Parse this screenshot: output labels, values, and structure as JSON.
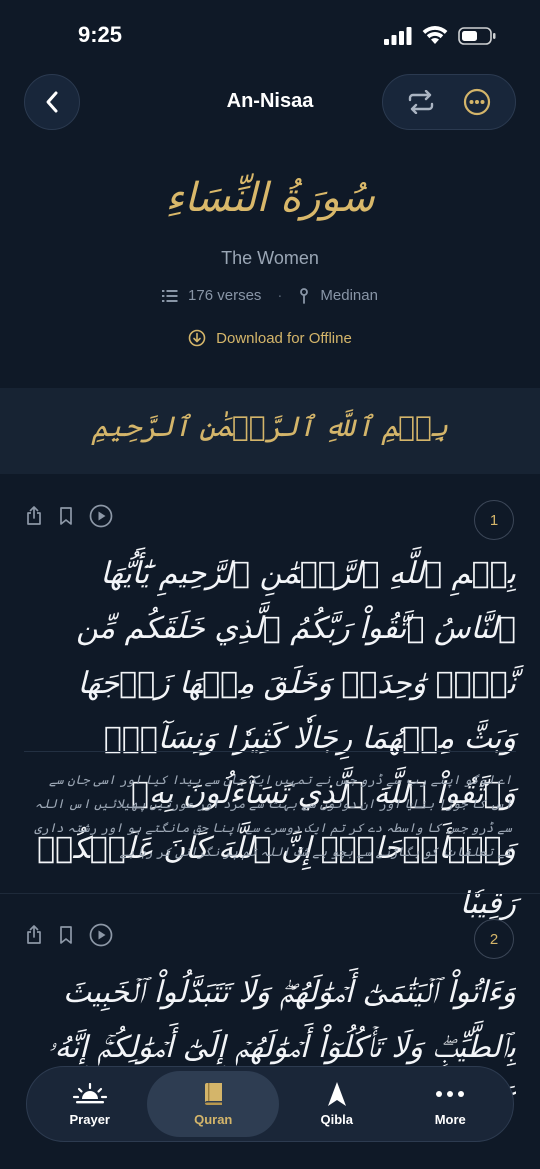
{
  "status": {
    "time": "9:25"
  },
  "header": {
    "title": "An-Nisaa"
  },
  "surah": {
    "arabic_name": "سُورَةُ النِّسَاءِ",
    "english_name": "The Women",
    "verses": "176 verses",
    "revelation": "Medinan",
    "download_label": "Download for Offline"
  },
  "bismillah": "بِسۡمِ ٱللَّهِ ٱلرَّحۡمَٰنِ ٱلرَّحِيمِ",
  "verses": [
    {
      "number": "1",
      "arabic": "بِسۡمِ ٱللَّهِ ٱلرَّحۡمَٰنِ ٱلرَّحِيمِ يَٰٓأَيُّهَا ٱلنَّاسُ ٱتَّقُواْ رَبَّكُمُ ٱلَّذِي خَلَقَكُم مِّن نَّفۡسٖ وَٰحِدَةٖ وَخَلَقَ مِنۡهَا زَوۡجَهَا وَبَثَّ مِنۡهُمَا رِجَالٗا كَثِيرٗا وَنِسَآءٗۚ وَٱتَّقُواْ ٱللَّهَ ٱلَّذِي تَسَآءَلُونَ بِهِۦ وَٱلۡأَرۡحَامَۚ إِنَّ ٱللَّهَ كَانَ عَلَيۡكُمۡ رَقِيبٗا",
      "translation": "اے لوگو اپنے رب سے ڈرو جس نے تمہیں ایک جان سے پیدا کیا اور اسی جان سے اس کا جوڑا بنایا اور ان دونوں سے بہت سے مرد اور عورتیں پھیلائیں اس اللہ سے ڈرو جس کا واسطہ دے کر تم ایک دوسرے سے اپنا حق مانگتے ہو اور رشتہ داری کے تعلقات کو بگاڑنے سے بچو بے شک اللہ تم پر نگرانی کر رہا ہے"
    },
    {
      "number": "2",
      "arabic": "وَءَاتُواْ ٱلۡيَتَٰمَىٰٓ أَمۡوَٰلَهُمۡۖ وَلَا تَتَبَدَّلُواْ ٱلۡخَبِيثَ بِٱلطَّيِّبِۖ وَلَا تَأۡكُلُوٓاْ أَمۡوَٰلَهُمۡ إِلَىٰٓ أَمۡوَٰلِكُمۡۚ إِنَّهُۥ كَانَ حُوبٗا كَبِيرٗا"
    }
  ],
  "nav": {
    "items": [
      {
        "label": "Prayer",
        "icon": "sunrise-icon"
      },
      {
        "label": "Quran",
        "icon": "book-icon"
      },
      {
        "label": "Qibla",
        "icon": "compass-arrow-icon"
      },
      {
        "label": "More",
        "icon": "dots-icon"
      }
    ],
    "active": "Quran"
  },
  "colors": {
    "accent": "#d4b56a",
    "background": "#0f1927"
  }
}
